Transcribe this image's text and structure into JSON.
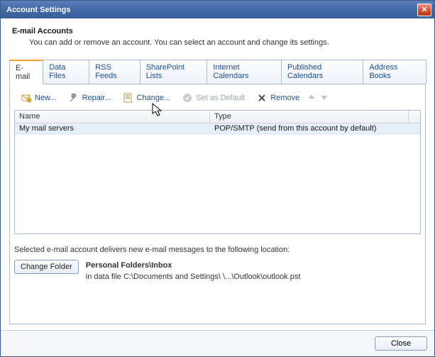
{
  "window": {
    "title": "Account Settings"
  },
  "header": {
    "title": "E-mail Accounts",
    "description": "You can add or remove an account. You can select an account and change its settings."
  },
  "tabs": [
    {
      "label": "E-mail",
      "active": true
    },
    {
      "label": "Data Files",
      "active": false
    },
    {
      "label": "RSS Feeds",
      "active": false
    },
    {
      "label": "SharePoint Lists",
      "active": false
    },
    {
      "label": "Internet Calendars",
      "active": false
    },
    {
      "label": "Published Calendars",
      "active": false
    },
    {
      "label": "Address Books",
      "active": false
    }
  ],
  "toolbar": {
    "new": "New...",
    "repair": "Repair...",
    "change": "Change...",
    "set_default": "Set as Default",
    "remove": "Remove"
  },
  "columns": {
    "name": "Name",
    "type": "Type"
  },
  "accounts": [
    {
      "name": "My mail servers",
      "type": "POP/SMTP (send from this account by default)"
    }
  ],
  "delivery": {
    "intro": "Selected e-mail account delivers new e-mail messages to the following location:",
    "change_folder": "Change Folder",
    "location": "Personal Folders\\Inbox",
    "datafile": "in data file C:\\Documents and Settings\\         \\...\\Outlook\\outlook.pst"
  },
  "footer": {
    "close": "Close"
  }
}
